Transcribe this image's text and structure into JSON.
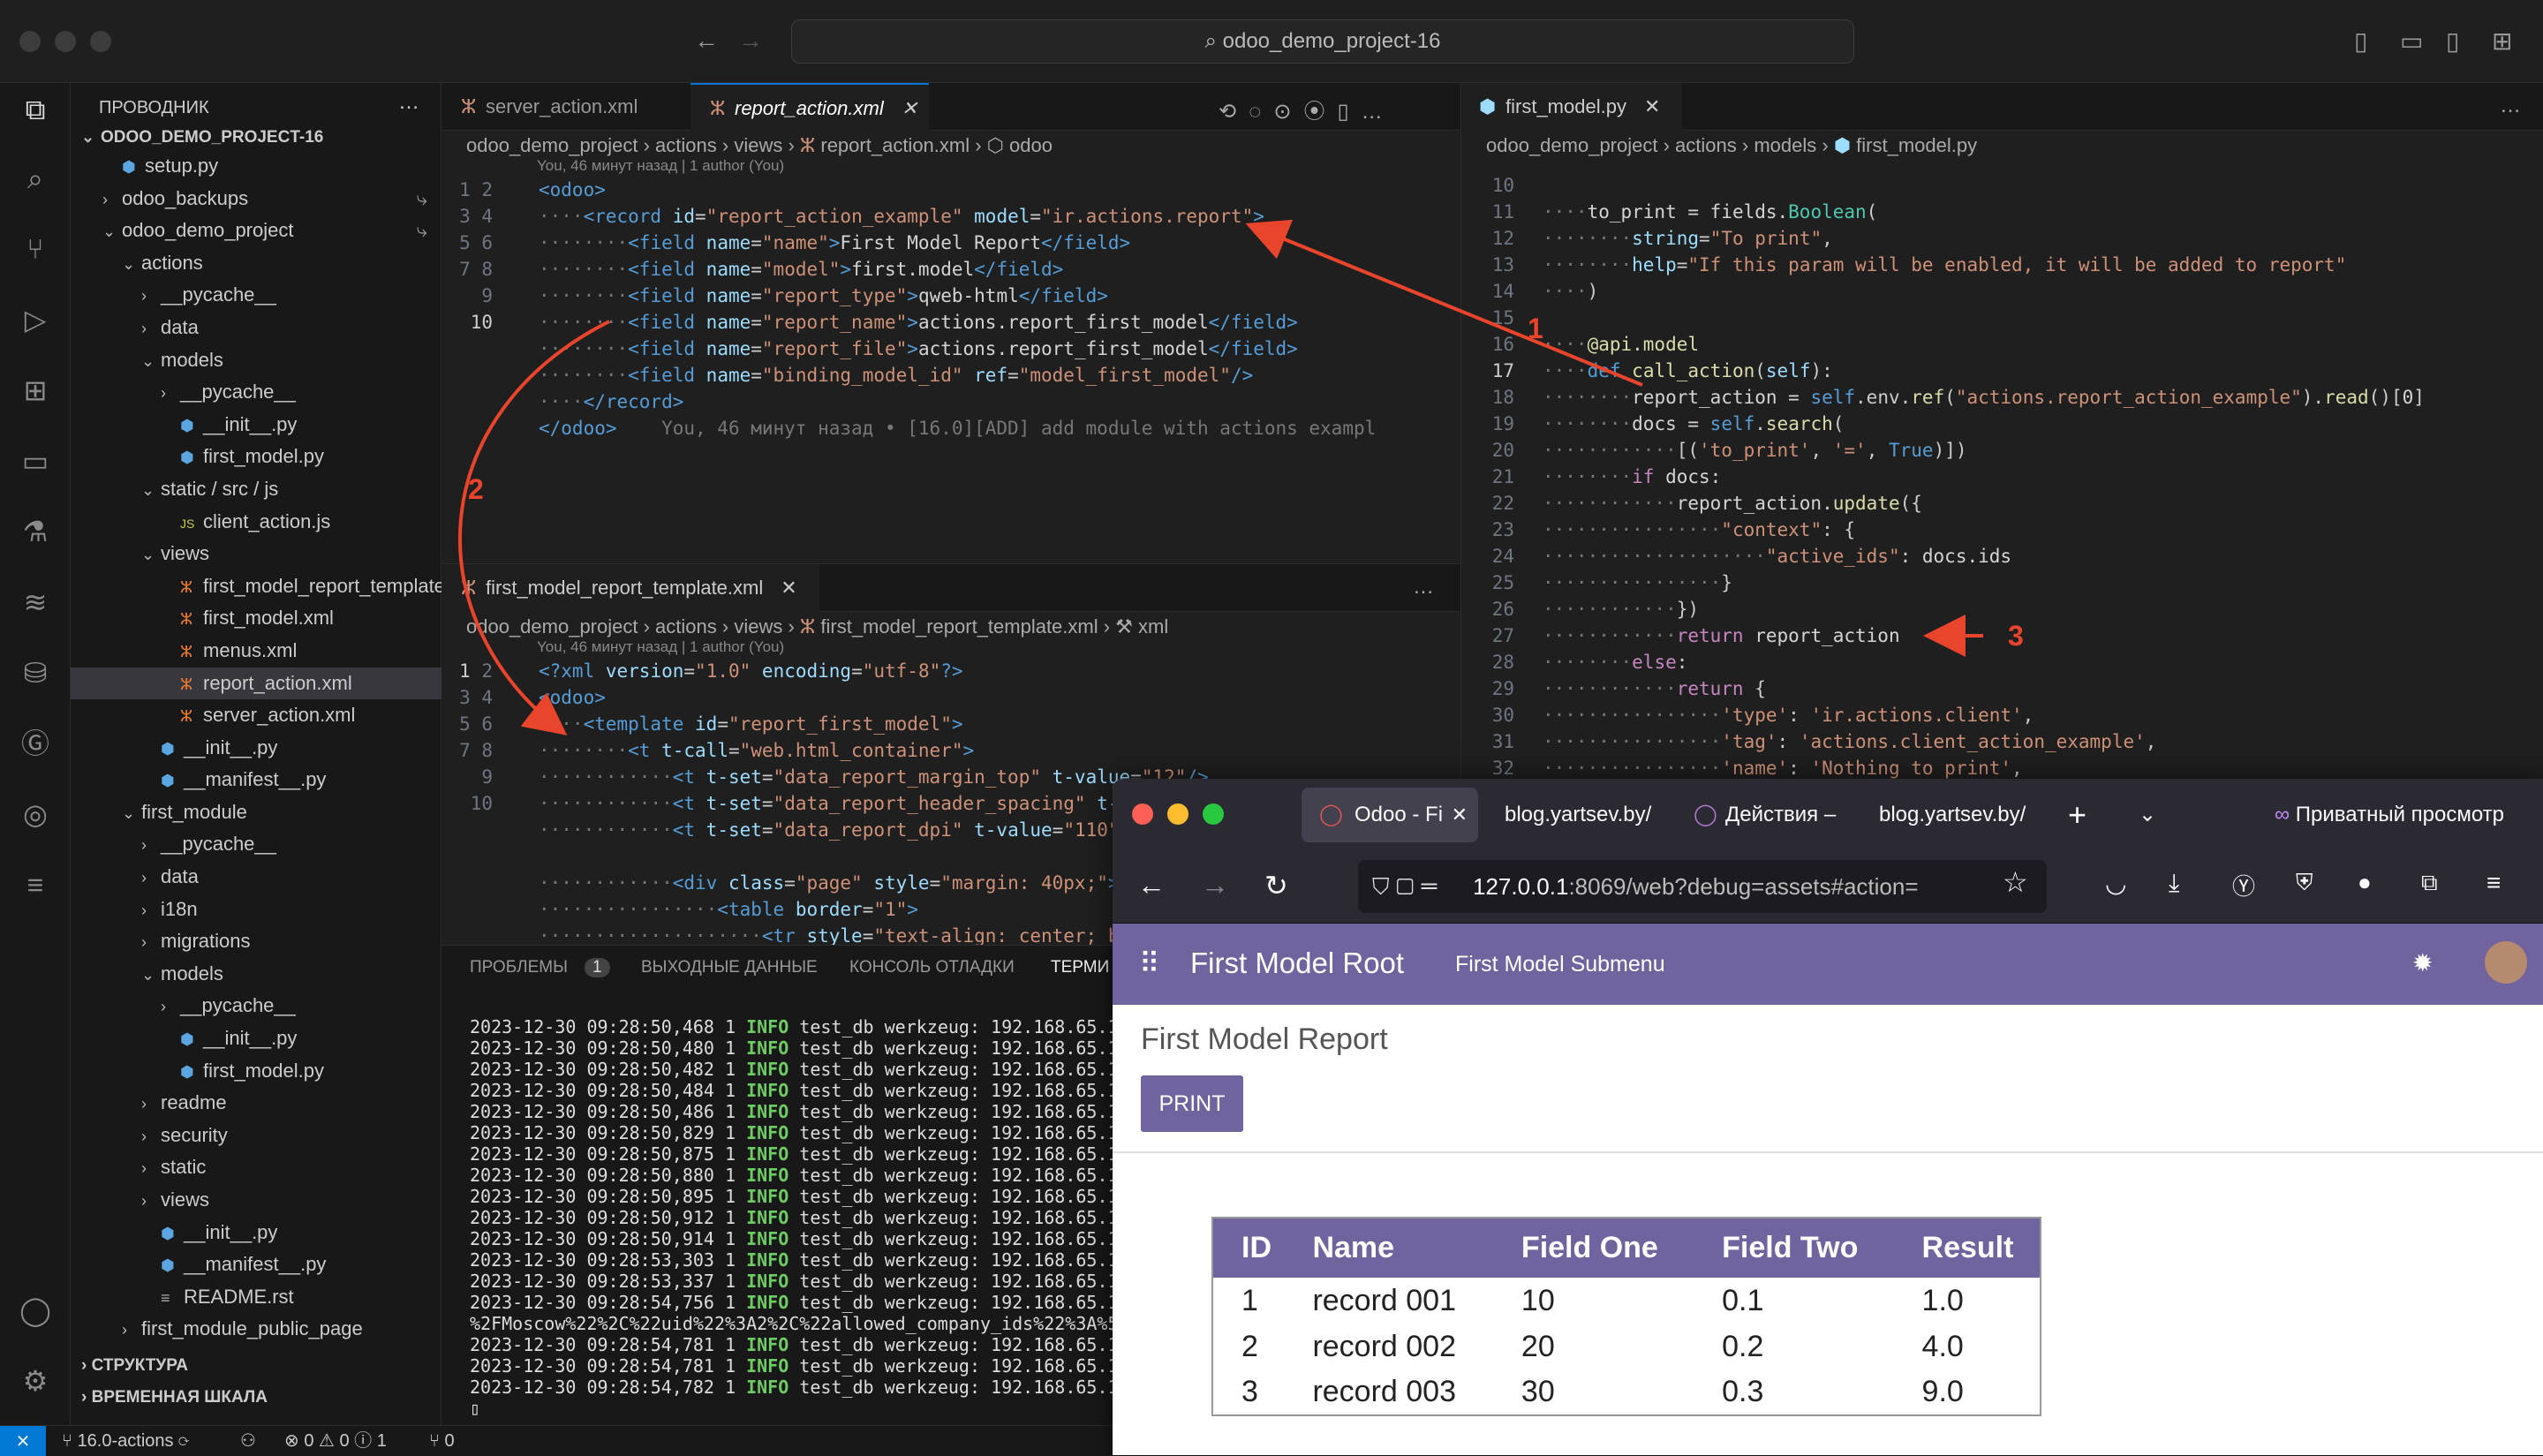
{
  "titlebar": {
    "search": "odoo_demo_project-16"
  },
  "sidebar": {
    "header": "ПРОВОДНИК",
    "project": "ODOO_DEMO_PROJECT-16",
    "items": [
      {
        "label": "setup.py",
        "type": "py",
        "depth": 1
      },
      {
        "label": "odoo_backups",
        "type": "folder-closed",
        "depth": 1
      },
      {
        "label": "odoo_demo_project",
        "type": "folder-open",
        "depth": 1
      },
      {
        "label": "actions",
        "type": "folder-open",
        "depth": 2
      },
      {
        "label": "__pycache__",
        "type": "folder-closed",
        "depth": 3
      },
      {
        "label": "data",
        "type": "folder-closed",
        "depth": 3
      },
      {
        "label": "models",
        "type": "folder-open",
        "depth": 3
      },
      {
        "label": "__pycache__",
        "type": "folder-closed",
        "depth": 4
      },
      {
        "label": "__init__.py",
        "type": "py",
        "depth": 4
      },
      {
        "label": "first_model.py",
        "type": "py",
        "depth": 4
      },
      {
        "label": "static / src / js",
        "type": "folder-open",
        "depth": 3
      },
      {
        "label": "client_action.js",
        "type": "js",
        "depth": 4
      },
      {
        "label": "views",
        "type": "folder-open",
        "depth": 3
      },
      {
        "label": "first_model_report_template....",
        "type": "xml",
        "depth": 4
      },
      {
        "label": "first_model.xml",
        "type": "xml",
        "depth": 4
      },
      {
        "label": "menus.xml",
        "type": "xml",
        "depth": 4
      },
      {
        "label": "report_action.xml",
        "type": "xml",
        "depth": 4,
        "selected": true
      },
      {
        "label": "server_action.xml",
        "type": "xml",
        "depth": 4
      },
      {
        "label": "__init__.py",
        "type": "py",
        "depth": 3
      },
      {
        "label": "__manifest__.py",
        "type": "py",
        "depth": 3
      },
      {
        "label": "first_module",
        "type": "folder-open",
        "depth": 2
      },
      {
        "label": "__pycache__",
        "type": "folder-closed",
        "depth": 3
      },
      {
        "label": "data",
        "type": "folder-closed",
        "depth": 3
      },
      {
        "label": "i18n",
        "type": "folder-closed",
        "depth": 3
      },
      {
        "label": "migrations",
        "type": "folder-closed",
        "depth": 3
      },
      {
        "label": "models",
        "type": "folder-open",
        "depth": 3
      },
      {
        "label": "__pycache__",
        "type": "folder-closed",
        "depth": 4
      },
      {
        "label": "__init__.py",
        "type": "py",
        "depth": 4
      },
      {
        "label": "first_model.py",
        "type": "py",
        "depth": 4
      },
      {
        "label": "readme",
        "type": "folder-closed",
        "depth": 3
      },
      {
        "label": "security",
        "type": "folder-closed",
        "depth": 3
      },
      {
        "label": "static",
        "type": "folder-closed",
        "depth": 3
      },
      {
        "label": "views",
        "type": "folder-closed",
        "depth": 3
      },
      {
        "label": "__init__.py",
        "type": "py",
        "depth": 3
      },
      {
        "label": "__manifest__.py",
        "type": "py",
        "depth": 3
      },
      {
        "label": "README.rst",
        "type": "txt",
        "depth": 3
      },
      {
        "label": "first_module_public_page",
        "type": "folder-closed",
        "depth": 2
      }
    ],
    "structure": "СТРУКТУРА",
    "timeline": "ВРЕМЕННАЯ ШКАЛА"
  },
  "editor1": {
    "tab1": "server_action.xml",
    "tab2": "report_action.xml",
    "crumbs": [
      "odoo_demo_project",
      "actions",
      "views",
      "report_action.xml",
      "odoo"
    ],
    "blame": "You, 46 минут назад | 1 author (You)",
    "inline_blame": "You, 46 минут назад • [16.0][ADD] add module with actions exampl"
  },
  "editor2": {
    "tab": "first_model_report_template.xml",
    "crumbs": [
      "odoo_demo_project",
      "actions",
      "views",
      "first_model_report_template.xml",
      "xml"
    ],
    "blame": "You, 46 минут назад | 1 author (You)"
  },
  "editor3": {
    "tab": "first_model.py",
    "crumbs": [
      "odoo_demo_project",
      "actions",
      "models",
      "first_model.py"
    ]
  },
  "annotations": [
    "1",
    "2",
    "3"
  ],
  "panel": {
    "tabs": [
      "ПРОБЛЕМЫ",
      "1",
      "ВЫХОДНЫЕ ДАННЫЕ",
      "КОНСОЛЬ ОТЛАДКИ",
      "ТЕРМИ"
    ],
    "lines": [
      [
        "2023-12-30 09:28:50,468 1 ",
        "INFO",
        " test_db werkzeug: 192.168.65.1"
      ],
      [
        "2023-12-30 09:28:50,480 1 ",
        "INFO",
        " test_db werkzeug: 192.168.65.1"
      ],
      [
        "2023-12-30 09:28:50,482 1 ",
        "INFO",
        " test_db werkzeug: 192.168.65.1"
      ],
      [
        "2023-12-30 09:28:50,484 1 ",
        "INFO",
        " test_db werkzeug: 192.168.65.1"
      ],
      [
        "2023-12-30 09:28:50,486 1 ",
        "INFO",
        " test_db werkzeug: 192.168.65.1"
      ],
      [
        "2023-12-30 09:28:50,829 1 ",
        "INFO",
        " test_db werkzeug: 192.168.65.1"
      ],
      [
        "2023-12-30 09:28:50,875 1 ",
        "INFO",
        " test_db werkzeug: 192.168.65.1"
      ],
      [
        "2023-12-30 09:28:50,880 1 ",
        "INFO",
        " test_db werkzeug: 192.168.65.1"
      ],
      [
        "2023-12-30 09:28:50,895 1 ",
        "INFO",
        " test_db werkzeug: 192.168.65.1"
      ],
      [
        "2023-12-30 09:28:50,912 1 ",
        "INFO",
        " test_db werkzeug: 192.168.65.1"
      ],
      [
        "2023-12-30 09:28:50,914 1 ",
        "INFO",
        " test_db werkzeug: 192.168.65.1"
      ],
      [
        "2023-12-30 09:28:53,303 1 ",
        "INFO",
        " test_db werkzeug: 192.168.65.1"
      ],
      [
        "2023-12-30 09:28:53,337 1 ",
        "INFO",
        " test_db werkzeug: 192.168.65.1"
      ],
      [
        "2023-12-30 09:28:54,756 1 ",
        "INFO",
        " test_db werkzeug: 192.168.65.1"
      ],
      [
        "%2FMoscow%22%2C%22uid%22%3A2%2C%22allowed_company_ids%22%3A%5",
        "",
        ""
      ],
      [
        "2023-12-30 09:28:54,781 1 ",
        "INFO",
        " test_db werkzeug: 192.168.65.1"
      ],
      [
        "2023-12-30 09:28:54,781 1 ",
        "INFO",
        " test_db werkzeug: 192.168.65.1"
      ],
      [
        "2023-12-30 09:28:54,782 1 ",
        "INFO",
        " test_db werkzeug: 192.168.65.1"
      ]
    ]
  },
  "status": {
    "branch": "16.0-actions",
    "problems": "⊗ 0 ⚠ 0 ⓘ 1",
    "ports": "⑂ 0"
  },
  "browser": {
    "tabs": [
      "Odoo - Fi",
      "blog.yartsev.by/",
      "Действия –",
      "blog.yartsev.by/"
    ],
    "private": "Приватный просмотр",
    "url_host": "127.0.0.1",
    "url_rest": ":8069/web?debug=assets#action=",
    "app_name": "First Model Root",
    "submenu": "First Model Submenu",
    "report_title": "First Model Report",
    "print_label": "PRINT",
    "table": {
      "headers": [
        "ID",
        "Name",
        "Field One",
        "Field Two",
        "Result"
      ],
      "rows": [
        [
          "1",
          "record 001",
          "10",
          "0.1",
          "1.0"
        ],
        [
          "2",
          "record 002",
          "20",
          "0.2",
          "4.0"
        ],
        [
          "3",
          "record 003",
          "30",
          "0.3",
          "9.0"
        ]
      ]
    }
  },
  "colors": {
    "accent": "#0078d4",
    "odoo": "#71639e",
    "arrow": "#e8452c"
  }
}
